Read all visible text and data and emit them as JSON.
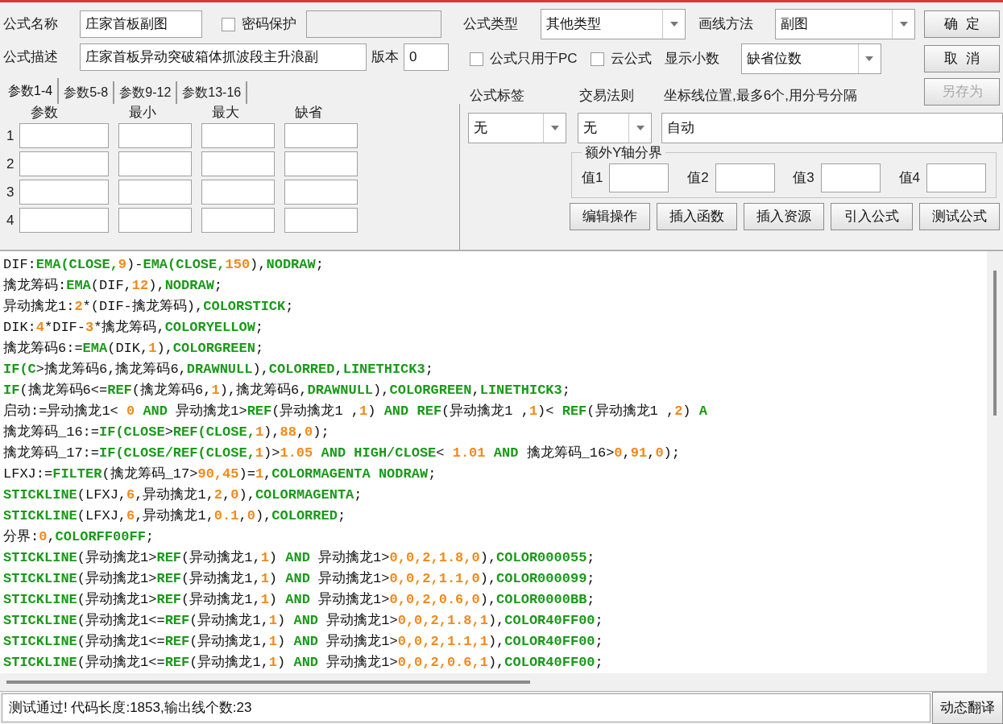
{
  "form": {
    "name_label": "公式名称",
    "name_value": "庄家首板副图",
    "password": {
      "label": "密码保护",
      "checked": false
    },
    "desc_label": "公式描述",
    "desc_value": "庄家首板异动突破箱体抓波段主升浪副",
    "version_label": "版本",
    "version_value": "0"
  },
  "param_tabs": [
    {
      "label": "参数1-4",
      "selected": true
    },
    {
      "label": "参数5-8",
      "selected": false
    },
    {
      "label": "参数9-12",
      "selected": false
    },
    {
      "label": "参数13-16",
      "selected": false
    }
  ],
  "param_columns": [
    "参数",
    "最小",
    "最大",
    "缺省"
  ],
  "param_rows": [
    "1",
    "2",
    "3",
    "4"
  ],
  "type": {
    "label": "公式类型",
    "value": "其他类型"
  },
  "draw_method": {
    "label": "画线方法",
    "value": "副图"
  },
  "pc_only": {
    "label": "公式只用于PC",
    "checked": false
  },
  "cloud": {
    "label": "云公式",
    "checked": false
  },
  "decimals": {
    "label": "显示小数",
    "value": "缺省位数"
  },
  "tag": {
    "label": "公式标签",
    "value": "无"
  },
  "rule": {
    "label": "交易法则",
    "value": "无"
  },
  "axis": {
    "label": "坐标线位置,最多6个,用分号分隔",
    "value": "自动"
  },
  "y_bounds": {
    "title": "额外Y轴分界",
    "labels": [
      "值1",
      "值2",
      "值3",
      "值4"
    ]
  },
  "side_buttons": [
    {
      "label": "确  定",
      "disabled": false
    },
    {
      "label": "取  消",
      "disabled": false
    },
    {
      "label": "另存为",
      "disabled": true
    }
  ],
  "tool_buttons": [
    "编辑操作",
    "插入函数",
    "插入资源",
    "引入公式",
    "测试公式"
  ],
  "code_lines": [
    [
      {
        "kind": "plain",
        "text": "DIF:"
      },
      {
        "kind": "func",
        "text": "EMA(CLOSE,"
      },
      {
        "kind": "num",
        "text": "9"
      },
      {
        "kind": "plain",
        "text": ")-"
      },
      {
        "kind": "func",
        "text": "EMA(CLOSE,"
      },
      {
        "kind": "num",
        "text": "150"
      },
      {
        "kind": "plain",
        "text": "),"
      },
      {
        "kind": "func",
        "text": "NODRAW"
      },
      {
        "kind": "plain",
        "text": ";"
      }
    ],
    [
      {
        "kind": "plain",
        "text": "擒龙筹码:"
      },
      {
        "kind": "func",
        "text": "EMA"
      },
      {
        "kind": "plain",
        "text": "(DIF,"
      },
      {
        "kind": "num",
        "text": "12"
      },
      {
        "kind": "plain",
        "text": "),"
      },
      {
        "kind": "func",
        "text": "NODRAW"
      },
      {
        "kind": "plain",
        "text": ";"
      }
    ],
    [
      {
        "kind": "plain",
        "text": "异动擒龙1:"
      },
      {
        "kind": "num",
        "text": "2"
      },
      {
        "kind": "plain",
        "text": "*(DIF-擒龙筹码),"
      },
      {
        "kind": "func",
        "text": "COLORSTICK"
      },
      {
        "kind": "plain",
        "text": ";"
      }
    ],
    [
      {
        "kind": "plain",
        "text": "DIK:"
      },
      {
        "kind": "num",
        "text": "4"
      },
      {
        "kind": "plain",
        "text": "*DIF-"
      },
      {
        "kind": "num",
        "text": "3"
      },
      {
        "kind": "plain",
        "text": "*擒龙筹码,"
      },
      {
        "kind": "func",
        "text": "COLORYELLOW"
      },
      {
        "kind": "plain",
        "text": ";"
      }
    ],
    [
      {
        "kind": "plain",
        "text": "擒龙筹码6:="
      },
      {
        "kind": "func",
        "text": "EMA"
      },
      {
        "kind": "plain",
        "text": "(DIK,"
      },
      {
        "kind": "num",
        "text": "1"
      },
      {
        "kind": "plain",
        "text": "),"
      },
      {
        "kind": "func",
        "text": "COLORGREEN"
      },
      {
        "kind": "plain",
        "text": ";"
      }
    ],
    [
      {
        "kind": "func",
        "text": "IF(C"
      },
      {
        "kind": "plain",
        "text": ">擒龙筹码6,擒龙筹码6,"
      },
      {
        "kind": "func",
        "text": "DRAWNULL"
      },
      {
        "kind": "plain",
        "text": "),"
      },
      {
        "kind": "func",
        "text": "COLORRED"
      },
      {
        "kind": "plain",
        "text": ","
      },
      {
        "kind": "func",
        "text": "LINETHICK3"
      },
      {
        "kind": "plain",
        "text": ";"
      }
    ],
    [
      {
        "kind": "func",
        "text": "IF"
      },
      {
        "kind": "plain",
        "text": "(擒龙筹码6<="
      },
      {
        "kind": "func",
        "text": "REF"
      },
      {
        "kind": "plain",
        "text": "(擒龙筹码6,"
      },
      {
        "kind": "num",
        "text": "1"
      },
      {
        "kind": "plain",
        "text": "),擒龙筹码6,"
      },
      {
        "kind": "func",
        "text": "DRAWNULL"
      },
      {
        "kind": "plain",
        "text": "),"
      },
      {
        "kind": "func",
        "text": "COLORGREEN"
      },
      {
        "kind": "plain",
        "text": ","
      },
      {
        "kind": "func",
        "text": "LINETHICK3"
      },
      {
        "kind": "plain",
        "text": ";"
      }
    ],
    [
      {
        "kind": "plain",
        "text": "启动:=异动擒龙1< "
      },
      {
        "kind": "num",
        "text": "0"
      },
      {
        "kind": "func",
        "text": " AND "
      },
      {
        "kind": "plain",
        "text": "异动擒龙1>"
      },
      {
        "kind": "func",
        "text": "REF"
      },
      {
        "kind": "plain",
        "text": "(异动擒龙1 ,"
      },
      {
        "kind": "num",
        "text": "1"
      },
      {
        "kind": "plain",
        "text": ")"
      },
      {
        "kind": "func",
        "text": " AND REF"
      },
      {
        "kind": "plain",
        "text": "(异动擒龙1 ,"
      },
      {
        "kind": "num",
        "text": "1"
      },
      {
        "kind": "plain",
        "text": ")< "
      },
      {
        "kind": "func",
        "text": "REF"
      },
      {
        "kind": "plain",
        "text": "(异动擒龙1 ,"
      },
      {
        "kind": "num",
        "text": "2"
      },
      {
        "kind": "plain",
        "text": ") "
      },
      {
        "kind": "func",
        "text": "A"
      }
    ],
    [
      {
        "kind": "plain",
        "text": "擒龙筹码_16:="
      },
      {
        "kind": "func",
        "text": "IF(CLOSE"
      },
      {
        "kind": "plain",
        "text": ">"
      },
      {
        "kind": "func",
        "text": "REF(CLOSE,"
      },
      {
        "kind": "num",
        "text": "1"
      },
      {
        "kind": "plain",
        "text": "),"
      },
      {
        "kind": "num",
        "text": "88"
      },
      {
        "kind": "plain",
        "text": ","
      },
      {
        "kind": "num",
        "text": "0"
      },
      {
        "kind": "plain",
        "text": ");"
      }
    ],
    [
      {
        "kind": "plain",
        "text": "擒龙筹码_17:="
      },
      {
        "kind": "func",
        "text": "IF(CLOSE/REF(CLOSE,"
      },
      {
        "kind": "num",
        "text": "1"
      },
      {
        "kind": "plain",
        "text": ")>"
      },
      {
        "kind": "num",
        "text": "1.05"
      },
      {
        "kind": "func",
        "text": " AND HIGH/CLOSE"
      },
      {
        "kind": "plain",
        "text": "< "
      },
      {
        "kind": "num",
        "text": "1.01"
      },
      {
        "kind": "func",
        "text": " AND "
      },
      {
        "kind": "plain",
        "text": "擒龙筹码_16>"
      },
      {
        "kind": "num",
        "text": "0"
      },
      {
        "kind": "plain",
        "text": ","
      },
      {
        "kind": "num",
        "text": "91"
      },
      {
        "kind": "plain",
        "text": ","
      },
      {
        "kind": "num",
        "text": "0"
      },
      {
        "kind": "plain",
        "text": ");"
      }
    ],
    [
      {
        "kind": "plain",
        "text": "LFXJ:="
      },
      {
        "kind": "func",
        "text": "FILTER"
      },
      {
        "kind": "plain",
        "text": "(擒龙筹码_17>"
      },
      {
        "kind": "num",
        "text": "90,45"
      },
      {
        "kind": "plain",
        "text": ")="
      },
      {
        "kind": "num",
        "text": "1"
      },
      {
        "kind": "plain",
        "text": ","
      },
      {
        "kind": "func",
        "text": "COLORMAGENTA NODRAW"
      },
      {
        "kind": "plain",
        "text": ";"
      }
    ],
    [
      {
        "kind": "func",
        "text": "STICKLINE"
      },
      {
        "kind": "plain",
        "text": "(LFXJ,"
      },
      {
        "kind": "num",
        "text": "6"
      },
      {
        "kind": "plain",
        "text": ",异动擒龙1,"
      },
      {
        "kind": "num",
        "text": "2"
      },
      {
        "kind": "plain",
        "text": ","
      },
      {
        "kind": "num",
        "text": "0"
      },
      {
        "kind": "plain",
        "text": "),"
      },
      {
        "kind": "func",
        "text": "COLORMAGENTA"
      },
      {
        "kind": "plain",
        "text": ";"
      }
    ],
    [
      {
        "kind": "func",
        "text": "STICKLINE"
      },
      {
        "kind": "plain",
        "text": "(LFXJ,"
      },
      {
        "kind": "num",
        "text": "6"
      },
      {
        "kind": "plain",
        "text": ",异动擒龙1,"
      },
      {
        "kind": "num",
        "text": "0.1"
      },
      {
        "kind": "plain",
        "text": ","
      },
      {
        "kind": "num",
        "text": "0"
      },
      {
        "kind": "plain",
        "text": "),"
      },
      {
        "kind": "func",
        "text": "COLORRED"
      },
      {
        "kind": "plain",
        "text": ";"
      }
    ],
    [
      {
        "kind": "plain",
        "text": "分界:"
      },
      {
        "kind": "num",
        "text": "0"
      },
      {
        "kind": "plain",
        "text": ","
      },
      {
        "kind": "func",
        "text": "COLORFF00FF"
      },
      {
        "kind": "plain",
        "text": ";"
      }
    ],
    [
      {
        "kind": "func",
        "text": "STICKLINE"
      },
      {
        "kind": "plain",
        "text": "(异动擒龙1>"
      },
      {
        "kind": "func",
        "text": "REF"
      },
      {
        "kind": "plain",
        "text": "(异动擒龙1,"
      },
      {
        "kind": "num",
        "text": "1"
      },
      {
        "kind": "plain",
        "text": ")"
      },
      {
        "kind": "func",
        "text": " AND "
      },
      {
        "kind": "plain",
        "text": "异动擒龙1>"
      },
      {
        "kind": "num",
        "text": "0,0,2,1.8,0"
      },
      {
        "kind": "plain",
        "text": "),"
      },
      {
        "kind": "func",
        "text": "COLOR000055"
      },
      {
        "kind": "plain",
        "text": ";"
      }
    ],
    [
      {
        "kind": "func",
        "text": "STICKLINE"
      },
      {
        "kind": "plain",
        "text": "(异动擒龙1>"
      },
      {
        "kind": "func",
        "text": "REF"
      },
      {
        "kind": "plain",
        "text": "(异动擒龙1,"
      },
      {
        "kind": "num",
        "text": "1"
      },
      {
        "kind": "plain",
        "text": ")"
      },
      {
        "kind": "func",
        "text": " AND "
      },
      {
        "kind": "plain",
        "text": "异动擒龙1>"
      },
      {
        "kind": "num",
        "text": "0,0,2,1.1,0"
      },
      {
        "kind": "plain",
        "text": "),"
      },
      {
        "kind": "func",
        "text": "COLOR000099"
      },
      {
        "kind": "plain",
        "text": ";"
      }
    ],
    [
      {
        "kind": "func",
        "text": "STICKLINE"
      },
      {
        "kind": "plain",
        "text": "(异动擒龙1>"
      },
      {
        "kind": "func",
        "text": "REF"
      },
      {
        "kind": "plain",
        "text": "(异动擒龙1,"
      },
      {
        "kind": "num",
        "text": "1"
      },
      {
        "kind": "plain",
        "text": ")"
      },
      {
        "kind": "func",
        "text": " AND "
      },
      {
        "kind": "plain",
        "text": "异动擒龙1>"
      },
      {
        "kind": "num",
        "text": "0,0,2,0.6,0"
      },
      {
        "kind": "plain",
        "text": "),"
      },
      {
        "kind": "func",
        "text": "COLOR0000BB"
      },
      {
        "kind": "plain",
        "text": ";"
      }
    ],
    [
      {
        "kind": "func",
        "text": "STICKLINE"
      },
      {
        "kind": "plain",
        "text": "(异动擒龙1<="
      },
      {
        "kind": "func",
        "text": "REF"
      },
      {
        "kind": "plain",
        "text": "(异动擒龙1,"
      },
      {
        "kind": "num",
        "text": "1"
      },
      {
        "kind": "plain",
        "text": ")"
      },
      {
        "kind": "func",
        "text": " AND "
      },
      {
        "kind": "plain",
        "text": "异动擒龙1>"
      },
      {
        "kind": "num",
        "text": "0,0,2,1.8,1"
      },
      {
        "kind": "plain",
        "text": "),"
      },
      {
        "kind": "func",
        "text": "COLOR40FF00"
      },
      {
        "kind": "plain",
        "text": ";"
      }
    ],
    [
      {
        "kind": "func",
        "text": "STICKLINE"
      },
      {
        "kind": "plain",
        "text": "(异动擒龙1<="
      },
      {
        "kind": "func",
        "text": "REF"
      },
      {
        "kind": "plain",
        "text": "(异动擒龙1,"
      },
      {
        "kind": "num",
        "text": "1"
      },
      {
        "kind": "plain",
        "text": ")"
      },
      {
        "kind": "func",
        "text": " AND "
      },
      {
        "kind": "plain",
        "text": "异动擒龙1>"
      },
      {
        "kind": "num",
        "text": "0,0,2,1.1,1"
      },
      {
        "kind": "plain",
        "text": "),"
      },
      {
        "kind": "func",
        "text": "COLOR40FF00"
      },
      {
        "kind": "plain",
        "text": ";"
      }
    ],
    [
      {
        "kind": "func",
        "text": "STICKLINE"
      },
      {
        "kind": "plain",
        "text": "(异动擒龙1<="
      },
      {
        "kind": "func",
        "text": "REF"
      },
      {
        "kind": "plain",
        "text": "(异动擒龙1,"
      },
      {
        "kind": "num",
        "text": "1"
      },
      {
        "kind": "plain",
        "text": ")"
      },
      {
        "kind": "func",
        "text": " AND "
      },
      {
        "kind": "plain",
        "text": "异动擒龙1>"
      },
      {
        "kind": "num",
        "text": "0,0,2,0.6,1"
      },
      {
        "kind": "plain",
        "text": "),"
      },
      {
        "kind": "func",
        "text": "COLOR40FF00"
      },
      {
        "kind": "plain",
        "text": ";"
      }
    ]
  ],
  "status": {
    "message": "测试通过! 代码长度:1853,输出线个数:23",
    "button": "动态翻译"
  }
}
